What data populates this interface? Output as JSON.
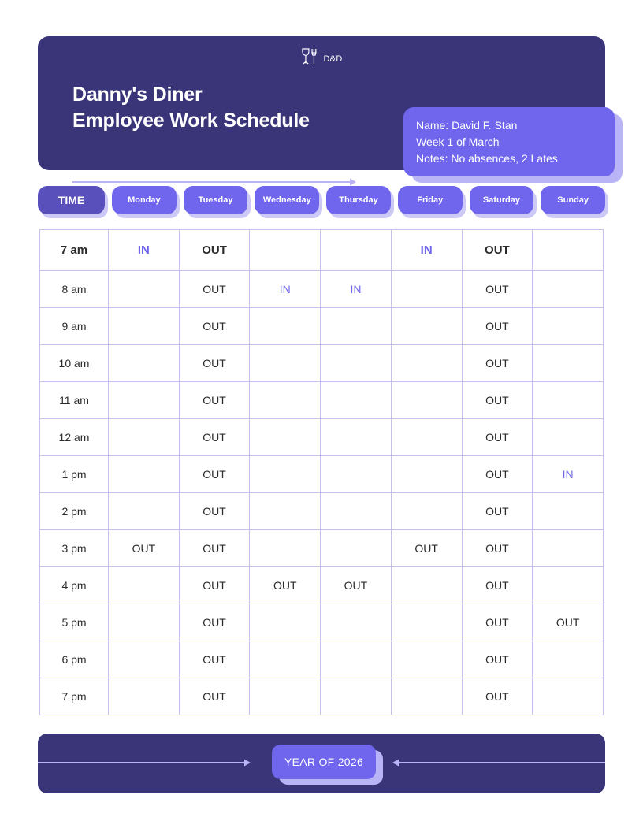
{
  "header": {
    "logo": {
      "icon": "glass-fork-icon",
      "text": "D&D"
    },
    "title_line1": "Danny's Diner",
    "title_line2": "Employee Work Schedule",
    "info": {
      "name_line": "Name: David F. Stan",
      "week_line": "Week 1 of March",
      "notes_line": "Notes: No absences, 2 Lates"
    }
  },
  "tabs": [
    {
      "label": "TIME",
      "active": true
    },
    {
      "label": "Monday",
      "active": false
    },
    {
      "label": "Tuesday",
      "active": false
    },
    {
      "label": "Wednesday",
      "active": false
    },
    {
      "label": "Thursday",
      "active": false
    },
    {
      "label": "Friday",
      "active": false
    },
    {
      "label": "Saturday",
      "active": false
    },
    {
      "label": "Sunday",
      "active": false
    }
  ],
  "table": {
    "columns": [
      "TIME",
      "Monday",
      "Tuesday",
      "Wednesday",
      "Thursday",
      "Friday",
      "Saturday",
      "Sunday"
    ],
    "rows": [
      {
        "time": "7 am",
        "cells": [
          "IN",
          "OUT",
          "",
          "",
          "IN",
          "OUT",
          ""
        ]
      },
      {
        "time": "8 am",
        "cells": [
          "",
          "OUT",
          "IN",
          "IN",
          "",
          "OUT",
          ""
        ]
      },
      {
        "time": "9 am",
        "cells": [
          "",
          "OUT",
          "",
          "",
          "",
          "OUT",
          ""
        ]
      },
      {
        "time": "10 am",
        "cells": [
          "",
          "OUT",
          "",
          "",
          "",
          "OUT",
          ""
        ]
      },
      {
        "time": "11 am",
        "cells": [
          "",
          "OUT",
          "",
          "",
          "",
          "OUT",
          ""
        ]
      },
      {
        "time": "12 am",
        "cells": [
          "",
          "OUT",
          "",
          "",
          "",
          "OUT",
          ""
        ]
      },
      {
        "time": "1 pm",
        "cells": [
          "",
          "OUT",
          "",
          "",
          "",
          "OUT",
          "IN"
        ]
      },
      {
        "time": "2 pm",
        "cells": [
          "",
          "OUT",
          "",
          "",
          "",
          "OUT",
          ""
        ]
      },
      {
        "time": "3 pm",
        "cells": [
          "OUT",
          "OUT",
          "",
          "",
          "OUT",
          "OUT",
          ""
        ]
      },
      {
        "time": "4 pm",
        "cells": [
          "",
          "OUT",
          "OUT",
          "OUT",
          "",
          "OUT",
          ""
        ]
      },
      {
        "time": "5 pm",
        "cells": [
          "",
          "OUT",
          "",
          "",
          "",
          "OUT",
          "OUT"
        ]
      },
      {
        "time": "6 pm",
        "cells": [
          "",
          "OUT",
          "",
          "",
          "",
          "OUT",
          ""
        ]
      },
      {
        "time": "7 pm",
        "cells": [
          "",
          "OUT",
          "",
          "",
          "",
          "OUT",
          ""
        ]
      }
    ]
  },
  "footer": {
    "year_label": "YEAR OF 2026"
  },
  "colors": {
    "dark_indigo": "#3a3578",
    "purple": "#6f66ed",
    "purple_dark": "#5950bb",
    "purple_shadow": "#cdc9f7",
    "grid_line": "#c4c0ee",
    "text": "#2b2b2b"
  }
}
